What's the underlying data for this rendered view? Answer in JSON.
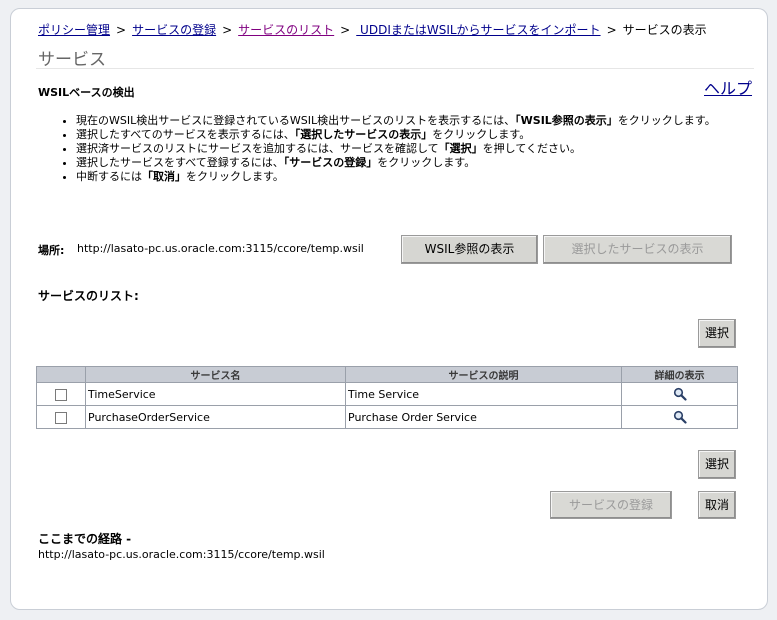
{
  "breadcrumb": {
    "items": [
      "ポリシー管理",
      "サービスの登録",
      "サービスのリスト",
      " UDDIまたはWSILからサービスをインポート"
    ],
    "current": "サービスの表示"
  },
  "page": {
    "title": "サービス",
    "help": "ヘルプ"
  },
  "section": {
    "heading": "WSILベースの検出",
    "bullets": [
      [
        "現在のWSIL検出サービスに登録されているWSIL検出サービスのリストを表示するには、",
        "「WSIL参照の表示」",
        "をクリックします。"
      ],
      [
        "選択したすべてのサービスを表示するには、",
        "「選択したサービスの表示」",
        "をクリックします。"
      ],
      [
        "選択済サービスのリストにサービスを追加するには、サービスを確認して",
        "「選択」",
        "を押してください。"
      ],
      [
        "選択したサービスをすべて登録するには、",
        "「サービスの登録」",
        "をクリックします。"
      ],
      [
        "中断するには",
        "「取消」",
        "をクリックします。"
      ]
    ]
  },
  "location": {
    "label": "場所:",
    "value": "http://lasato-pc.us.oracle.com:3115/ccore/temp.wsil",
    "show_wsil_button": "WSIL参照の表示",
    "show_selected_button": "選択したサービスの表示"
  },
  "service_list": {
    "title": "サービスのリスト:",
    "select_button": "選択",
    "columns": [
      "",
      "サービス名",
      "サービスの説明",
      "詳細の表示"
    ],
    "rows": [
      {
        "name": "TimeService",
        "description": "Time Service",
        "details_icon": "magnifier-icon"
      },
      {
        "name": "PurchaseOrderService",
        "description": "Purchase Order Service",
        "details_icon": "magnifier-icon"
      }
    ]
  },
  "actions": {
    "select_button": "選択",
    "register_button": "サービスの登録",
    "cancel_button": "取消"
  },
  "route": {
    "label": "ここまでの経路 -",
    "value": "http://lasato-pc.us.oracle.com:3115/ccore/temp.wsil"
  }
}
